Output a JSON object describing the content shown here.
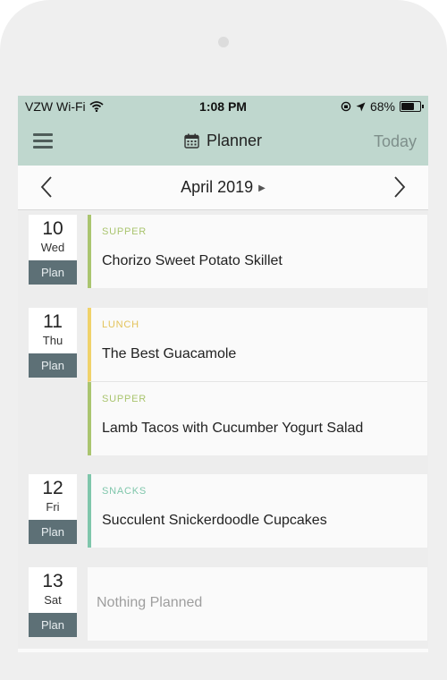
{
  "status_bar": {
    "carrier": "VZW Wi-Fi",
    "time": "1:08 PM",
    "battery": "68%"
  },
  "nav": {
    "title": "Planner",
    "today": "Today"
  },
  "month": {
    "label": "April 2019"
  },
  "days": [
    {
      "num": "10",
      "name": "Wed",
      "plan": "Plan",
      "meals": [
        {
          "type": "SUPPER",
          "title": "Chorizo Sweet Potato Skillet",
          "color": "#aac56f"
        }
      ]
    },
    {
      "num": "11",
      "name": "Thu",
      "plan": "Plan",
      "meals": [
        {
          "type": "LUNCH",
          "title": "The Best Guacamole",
          "color": "#f0d26a"
        },
        {
          "type": "SUPPER",
          "title": "Lamb Tacos with Cucumber Yogurt Salad",
          "color": "#aac56f"
        }
      ]
    },
    {
      "num": "12",
      "name": "Fri",
      "plan": "Plan",
      "meals": [
        {
          "type": "SNACKS",
          "title": "Succulent Snickerdoodle Cupcakes",
          "color": "#7fc6ab"
        }
      ]
    },
    {
      "num": "13",
      "name": "Sat",
      "plan": "Plan",
      "empty": "Nothing Planned"
    }
  ]
}
